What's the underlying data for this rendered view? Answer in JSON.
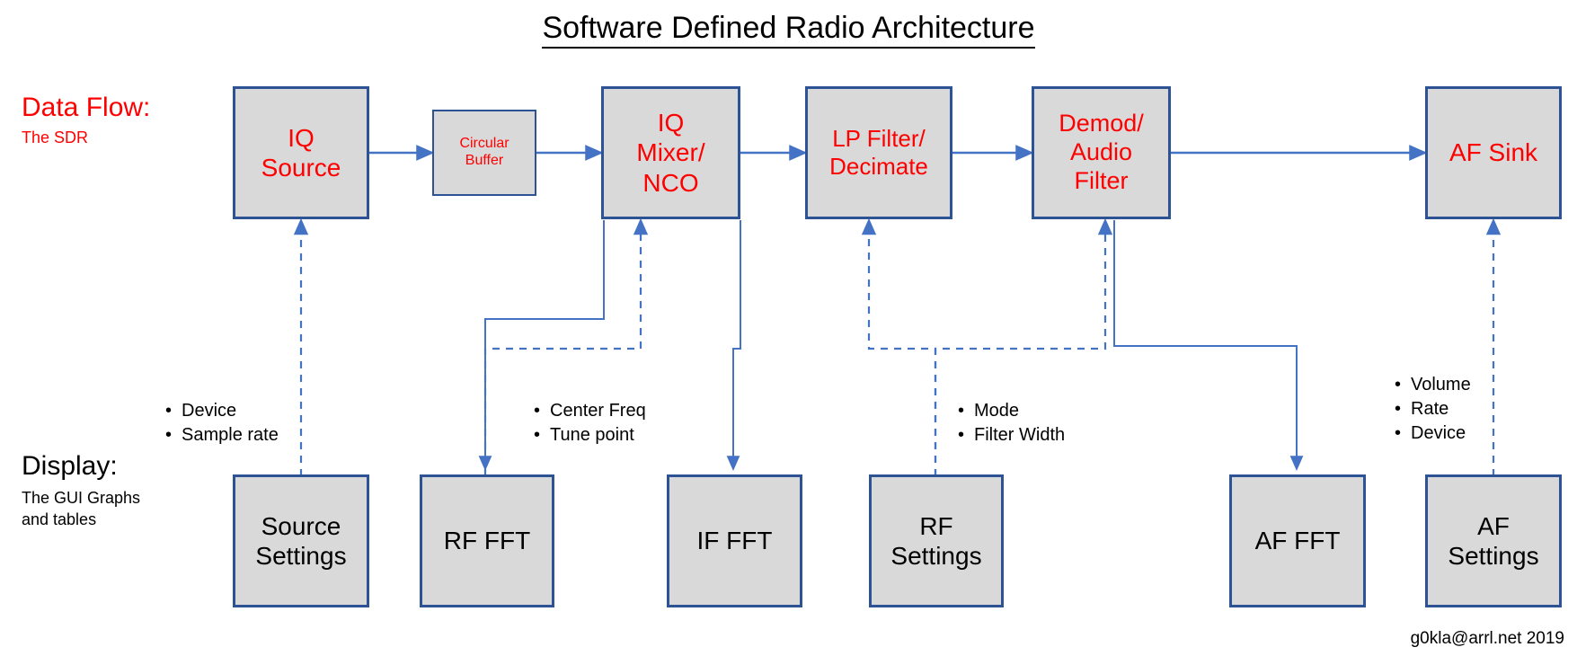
{
  "title": "Software Defined Radio Architecture",
  "credit": "g0kla@arrl.net 2019",
  "row_labels": {
    "dataflow": "Data Flow:",
    "dataflow_sub": "The SDR",
    "display": "Display:",
    "display_sub": "The GUI Graphs\nand tables"
  },
  "colors": {
    "box_fill": "#D9D9D9",
    "box_border": "#2E5395",
    "flow_text": "#FF0000",
    "display_text": "#000000",
    "wire": "#4472C4",
    "title_text": "#000000"
  },
  "pipeline": [
    {
      "id": "iq-source",
      "label": "IQ\nSource"
    },
    {
      "id": "circular-buffer",
      "label": "Circular\nBuffer"
    },
    {
      "id": "iq-mixer-nco",
      "label": "IQ\nMixer/\nNCO"
    },
    {
      "id": "lp-filter-decimate",
      "label": "LP Filter/\nDecimate"
    },
    {
      "id": "demod-audio-filter",
      "label": "Demod/\nAudio\nFilter"
    },
    {
      "id": "af-sink",
      "label": "AF Sink"
    }
  ],
  "display_nodes": [
    {
      "id": "source-settings",
      "label": "Source\nSettings"
    },
    {
      "id": "rf-fft",
      "label": "RF FFT"
    },
    {
      "id": "if-fft",
      "label": "IF FFT"
    },
    {
      "id": "rf-settings",
      "label": "RF\nSettings"
    },
    {
      "id": "af-fft",
      "label": "AF FFT"
    },
    {
      "id": "af-settings",
      "label": "AF\nSettings"
    }
  ],
  "bullet_groups": [
    {
      "id": "source-settings-bullets",
      "items": [
        "Device",
        "Sample rate"
      ]
    },
    {
      "id": "rf-settings-mixer-bullets",
      "items": [
        "Center Freq",
        "Tune point"
      ]
    },
    {
      "id": "rf-settings-bullets",
      "items": [
        "Mode",
        "Filter Width"
      ]
    },
    {
      "id": "af-settings-bullets",
      "items": [
        "Volume",
        "Rate",
        "Device"
      ]
    }
  ]
}
